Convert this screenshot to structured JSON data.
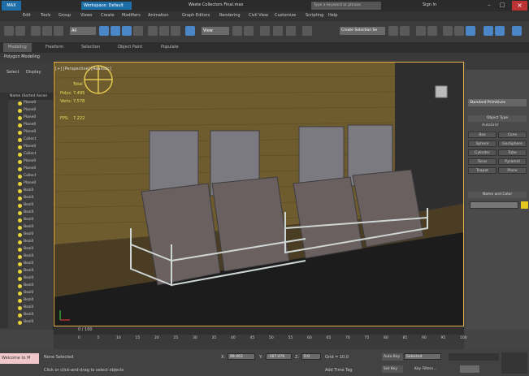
{
  "window": {
    "title": "Waste Collectors Final.max",
    "workspace": "Workspace: Default",
    "search_placeholder": "Type a keyword or phrase",
    "signin": "Sign In",
    "logo": "MAX"
  },
  "menu": [
    "Edit",
    "Tools",
    "Group",
    "Views",
    "Create",
    "Modifiers",
    "Animation",
    "Graph Editors",
    "Rendering",
    "Civil View",
    "Customize",
    "Scripting",
    "Help"
  ],
  "toolbar": {
    "filter_value": "All",
    "view_value": "View",
    "selection_set": "Create Selection Se"
  },
  "ribbon": {
    "tabs": [
      "Modeling",
      "Freeform",
      "Selection",
      "Object Paint",
      "Populate"
    ],
    "sub": "Polygon Modeling"
  },
  "scene": {
    "tabs": [
      "Select",
      "Display"
    ],
    "header": "Name (Sorted Ascen",
    "items": [
      "Plane0",
      "Plane0",
      "Plane0",
      "Plane0",
      "Plane0",
      "Collect",
      "Plane0",
      "Collect",
      "Plane0",
      "Plane0",
      "Collect",
      "Plane0",
      "Bezi0",
      "Bezi0",
      "Bezi0",
      "Bezi0",
      "Bezi0",
      "Bezi0",
      "Bezi0",
      "Bezi0",
      "Bezi0",
      "Bezi0",
      "Bezi0",
      "Bezi0",
      "Bezi0",
      "Bezi0",
      "Bezi0",
      "Bezi0",
      "Bezi0",
      "Bezi0",
      "Bezi0"
    ]
  },
  "viewport": {
    "label": "[+] [Perspective] [Realistic]",
    "stats": [
      {
        "k": "Total",
        "v": ""
      },
      {
        "k": "Polys:",
        "v": "7,495"
      },
      {
        "k": "Verts:",
        "v": "7,578"
      }
    ],
    "fps_k": "FPS:",
    "fps_v": "7.222"
  },
  "cmd": {
    "dropdown": "Standard Primitives",
    "rollout1": "Object Type",
    "autogrid": "AutoGrid",
    "buttons": [
      "Box",
      "Cone",
      "Sphere",
      "GeoSphere",
      "Cylinder",
      "Tube",
      "Torus",
      "Pyramid",
      "Teapot",
      "Plane"
    ],
    "rollout2": "Name and Color"
  },
  "timeline": {
    "frame": "0 / 100",
    "ticks": [
      "0",
      "5",
      "10",
      "15",
      "20",
      "25",
      "30",
      "35",
      "40",
      "45",
      "50",
      "55",
      "60",
      "65",
      "70",
      "75",
      "80",
      "85",
      "90",
      "95",
      "100"
    ]
  },
  "status": {
    "welcome": "Welcome to M",
    "none_selected": "None Selected",
    "hint": "Click or click-and-drag to select objects",
    "x": "99.463",
    "y": "-167.476",
    "z": "0.0",
    "grid": "Grid = 10.0",
    "autokey": "Auto Key",
    "selected": "Selected",
    "setkey": "Set Key",
    "keyfilters": "Key Filters...",
    "addtime": "Add Time Tag"
  },
  "colors": {
    "viewport_border": "#e3b04a",
    "accent": "#2e8bde",
    "brick": "#6e5b2e"
  }
}
